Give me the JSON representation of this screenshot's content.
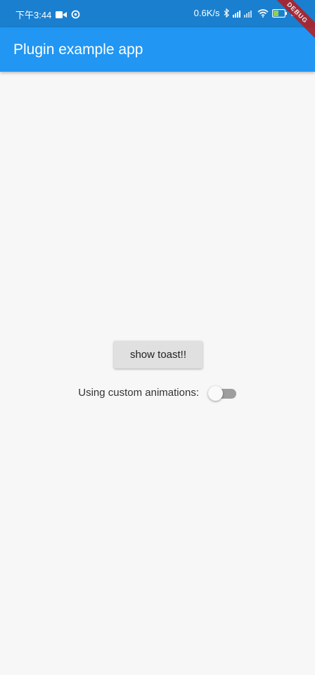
{
  "status_bar": {
    "time": "下午3:44",
    "net_speed": "0.6K/s",
    "battery": "38"
  },
  "app_bar": {
    "title": "Plugin example app"
  },
  "debug_banner": "DEBUG",
  "main": {
    "button_label": "show toast!!",
    "switch_label": "Using custom animations:",
    "switch_on": false
  },
  "colors": {
    "status_bar": "#1a7fcf",
    "app_bar": "#2196f3",
    "background": "#f7f7f7",
    "button": "#e0e0e0"
  },
  "icons": [
    "video-camera-icon",
    "sync-icon",
    "bluetooth-icon",
    "signal-icon",
    "wifi-icon",
    "battery-icon"
  ]
}
